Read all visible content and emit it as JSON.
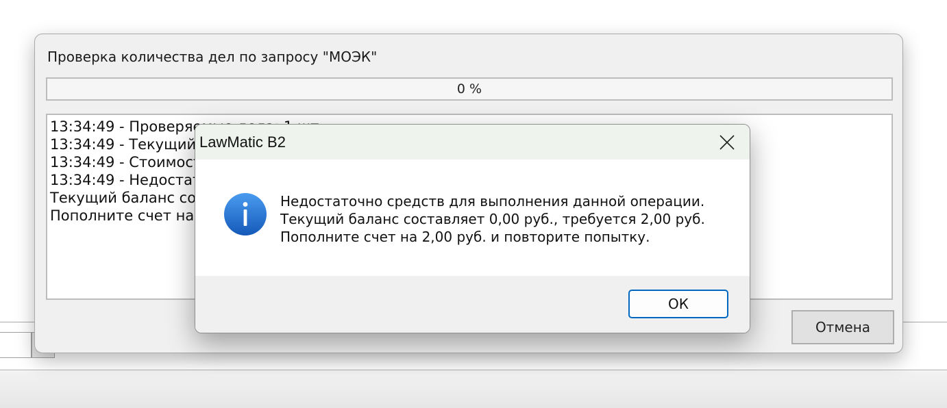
{
  "main_window": {
    "title": "Проверка количества дел по запросу \"МОЭК\"",
    "progress": {
      "value_percent": 0,
      "text": "0 %",
      "fill_color": "#06b025"
    },
    "log_lines": [
      "13:34:49 - Проверяемые дела: 1 шт.",
      "13:34:49 - Текущий баланс: 0,00 руб.",
      "13:34:49 - Стоимость проверки: 2,00 руб.",
      "13:34:49 - Недостаточно средств для выполнения данной операции.",
      "Текущий баланс составляет 0,00 руб., требуется 2,00 руб.",
      "Пополните счет на 2,00 руб. и повторите попытку."
    ],
    "cancel_label": "Отмена"
  },
  "message_box": {
    "title": "LawMatic B2",
    "icon": "info-icon",
    "icon_color": "#1e6fd2",
    "lines": [
      "Недостаточно средств для выполнения данной операции.",
      "Текущий баланс составляет 0,00 руб., требуется 2,00 руб.",
      "Пополните счет на 2,00 руб. и повторите попытку."
    ],
    "ok_label": "ОК",
    "accent_color": "#0067c0"
  }
}
